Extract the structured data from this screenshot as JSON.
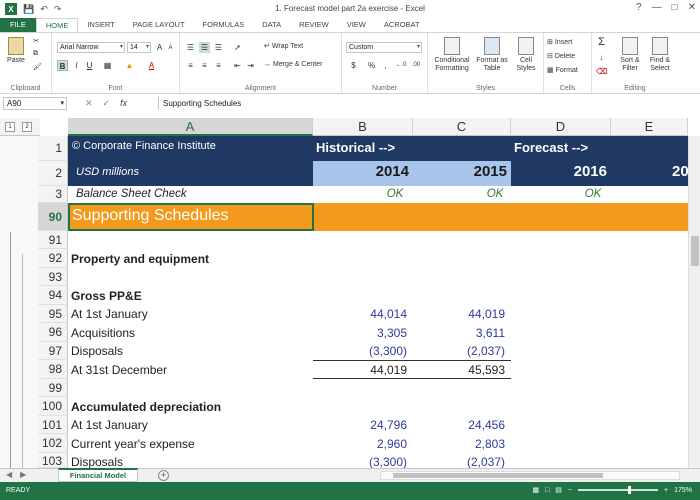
{
  "window": {
    "title": "1. Forecast model part 2a exercise - Excel",
    "app_icon_label": "X"
  },
  "ribbon": {
    "tabs": [
      "FILE",
      "HOME",
      "INSERT",
      "PAGE LAYOUT",
      "FORMULAS",
      "DATA",
      "REVIEW",
      "VIEW",
      "ACROBAT"
    ],
    "active_tab": "HOME",
    "clipboard": {
      "paste": "Paste",
      "label": "Clipboard"
    },
    "font": {
      "name": "Arial Narrow",
      "size": "14",
      "label": "Font",
      "bold": "B",
      "italic": "I",
      "underline": "U",
      "grow": "A",
      "shrink": "A"
    },
    "alignment": {
      "wrap": "Wrap Text",
      "merge": "Merge & Center",
      "label": "Alignment"
    },
    "number": {
      "format": "Custom",
      "currency": "$",
      "percent": "%",
      "comma": ",",
      "label": "Number",
      "inc_dec": "←.0",
      "dec_dec": ".00"
    },
    "styles": {
      "conditional": "Conditional Formatting",
      "format_table": "Format as Table",
      "cell_styles": "Cell Styles",
      "label": "Styles"
    },
    "cells": {
      "insert": "Insert",
      "delete": "Delete",
      "format": "Format",
      "label": "Cells"
    },
    "editing": {
      "sum": "Σ",
      "sort": "Sort & Filter",
      "find": "Find & Select",
      "label": "Editing"
    }
  },
  "formula_bar": {
    "name_box": "A90",
    "cancel": "✕",
    "enter": "✓",
    "fx": "fx",
    "content": "Supporting Schedules"
  },
  "columns": [
    "A",
    "B",
    "C",
    "D",
    "E"
  ],
  "outline_levels": [
    "1",
    "2"
  ],
  "rows": [
    {
      "num": "1",
      "a": "© Corporate Finance Institute",
      "b": "Historical -->",
      "c": "",
      "d": "Forecast -->",
      "e": ""
    },
    {
      "num": "2",
      "a": "USD millions",
      "b": "2014",
      "c": "2015",
      "d": "2016",
      "e": "20"
    },
    {
      "num": "3",
      "a": "Balance Sheet Check",
      "b": "OK",
      "c": "OK",
      "d": "OK",
      "e": ""
    },
    {
      "num": "90",
      "a": "Supporting Schedules",
      "b": "",
      "c": "",
      "d": "",
      "e": ""
    },
    {
      "num": "91",
      "a": "",
      "b": "",
      "c": ""
    },
    {
      "num": "92",
      "a": "Property and equipment",
      "b": "",
      "c": ""
    },
    {
      "num": "93",
      "a": "",
      "b": "",
      "c": ""
    },
    {
      "num": "94",
      "a": "Gross PP&E",
      "b": "",
      "c": ""
    },
    {
      "num": "95",
      "a": "At 1st January",
      "b": "44,014",
      "c": "44,019"
    },
    {
      "num": "96",
      "a": "Acquisitions",
      "b": "3,305",
      "c": "3,611"
    },
    {
      "num": "97",
      "a": "Disposals",
      "b": "(3,300)",
      "c": "(2,037)"
    },
    {
      "num": "98",
      "a": "At 31st December",
      "b": "44,019",
      "c": "45,593"
    },
    {
      "num": "99",
      "a": "",
      "b": "",
      "c": ""
    },
    {
      "num": "100",
      "a": "Accumulated depreciation",
      "b": "",
      "c": ""
    },
    {
      "num": "101",
      "a": "At 1st January",
      "b": "24,796",
      "c": "24,456"
    },
    {
      "num": "102",
      "a": "Current year's expense",
      "b": "2,960",
      "c": "2,803"
    },
    {
      "num": "103",
      "a": "Disposals",
      "b": "(3,300)",
      "c": "(2,037)"
    }
  ],
  "sheets": {
    "active": "Financial Model",
    "add": "+"
  },
  "status": {
    "ready": "READY",
    "zoom": "175%",
    "minus": "−",
    "plus": "+"
  },
  "colors": {
    "excel_green": "#217346",
    "navy": "#1f3864",
    "light_blue": "#a9c4eb",
    "orange": "#f39a1c",
    "blue_input": "#2b3c9c",
    "ok_green": "#2e7d32"
  }
}
